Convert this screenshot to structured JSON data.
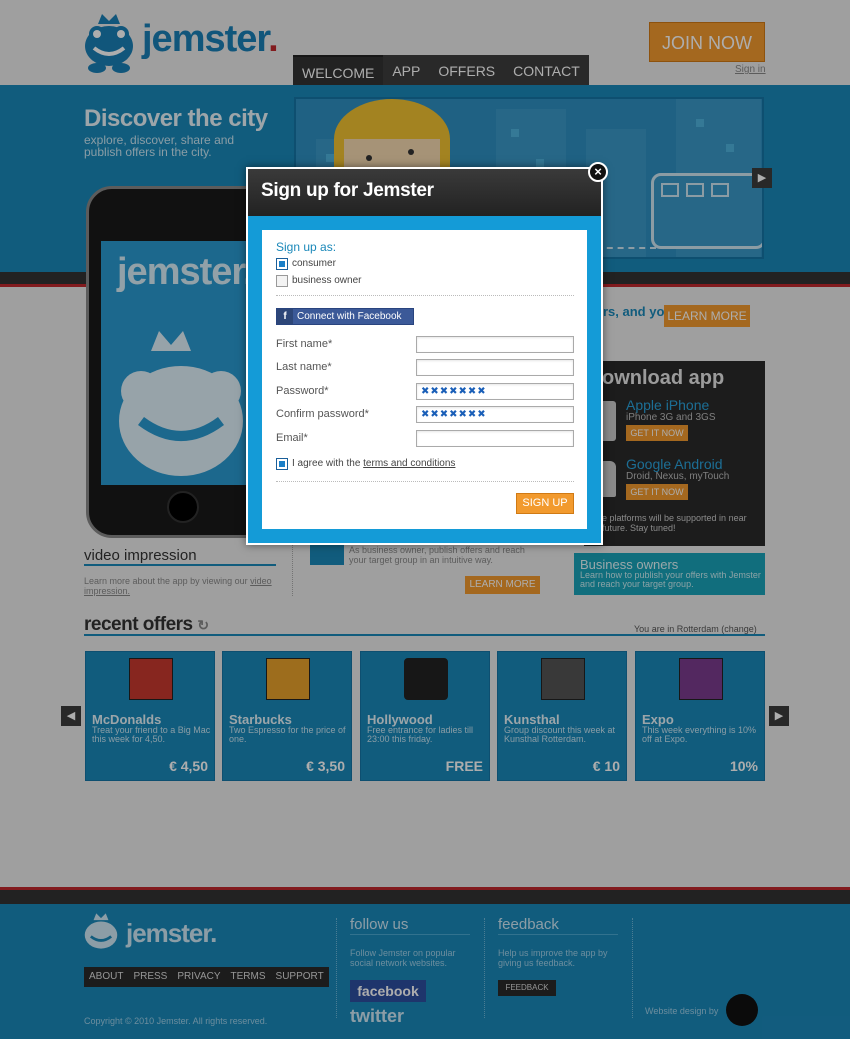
{
  "header": {
    "logo_text": "jemster",
    "logo_dot": ".",
    "nav": [
      {
        "label": "WELCOME",
        "active": true
      },
      {
        "label": "APP",
        "active": false
      },
      {
        "label": "OFFERS",
        "active": false
      },
      {
        "label": "CONTACT",
        "active": false
      }
    ],
    "join_label": "JOIN NOW",
    "signin_label": "Sign in"
  },
  "hero": {
    "title": "Discover the city",
    "subtitle": "explore, discover, share and publish offers in the city."
  },
  "iphone_logo": "jemster.",
  "promo": {
    "text": "rs, and you.",
    "learn_more": "LEARN MORE"
  },
  "download": {
    "title": "ownload app",
    "platforms": [
      {
        "name": "Apple iPhone",
        "desc": "iPhone 3G and 3GS",
        "cta": "GET IT NOW"
      },
      {
        "name": "Google Android",
        "desc": "Droid, Nexus, myTouch",
        "cta": "GET IT NOW"
      }
    ],
    "footnote": "e platforms will be supported in near future. Stay tuned!"
  },
  "video": {
    "title": "video impression",
    "desc": "Learn more about the app by viewing our",
    "link": "video impression."
  },
  "biz_middle": {
    "text": "As business owner, publish offers and reach your target group in an intuitive way.",
    "learn_more": "LEARN MORE"
  },
  "biz_box": {
    "title": "Business owners",
    "desc": "Learn how to publish your offers with Jemster and reach your target group."
  },
  "recent": {
    "title": "recent offers",
    "location": "You are in Rotterdam (change)",
    "offers": [
      {
        "name": "McDonalds",
        "desc": "Treat your friend to a Big Mac this week for 4,50.",
        "price": "€ 4,50",
        "icon": "tablecloth-icon"
      },
      {
        "name": "Starbucks",
        "desc": "Two Espresso for the price of one.",
        "price": "€ 3,50",
        "icon": "drink-icon"
      },
      {
        "name": "Hollywood",
        "desc": "Free entrance for ladies till 23:00 this friday.",
        "price": "FREE",
        "icon": "record-icon"
      },
      {
        "name": "Kunsthal",
        "desc": "Group discount this week at Kunsthal Rotterdam.",
        "price": "€ 10",
        "icon": "museum-icon"
      },
      {
        "name": "Expo",
        "desc": "This week everything is 10% off at Expo.",
        "price": "10%",
        "icon": "gift-icon"
      }
    ]
  },
  "footer": {
    "logo_text": "jemster.",
    "links": [
      "ABOUT",
      "PRESS",
      "PRIVACY",
      "TERMS",
      "SUPPORT"
    ],
    "copyright": "Copyright © 2010 Jemster. All rights reserved.",
    "follow_title": "follow us",
    "follow_desc": "Follow Jemster on popular social network websites.",
    "facebook": "facebook",
    "twitter": "twitter",
    "feedback_title": "feedback",
    "feedback_desc": "Help us improve the app by giving us feedback.",
    "feedback_btn": "FEEDBACK",
    "design_by": "Website design by"
  },
  "modal": {
    "title": "Sign up for Jemster",
    "close": "×",
    "signup_as": "Sign up as:",
    "options": [
      {
        "label": "consumer",
        "checked": true
      },
      {
        "label": "business owner",
        "checked": false
      }
    ],
    "facebook_connect": "Connect with Facebook",
    "fields": [
      {
        "label": "First name*",
        "value": ""
      },
      {
        "label": "Last name*",
        "value": ""
      },
      {
        "label": "Password*",
        "value": "✖✖✖✖✖✖✖"
      },
      {
        "label": "Confirm password*",
        "value": "✖✖✖✖✖✖✖"
      },
      {
        "label": "Email*",
        "value": ""
      }
    ],
    "agree_prefix": "I agree with the ",
    "agree_link": "terms and conditions",
    "submit": "SIGN UP"
  }
}
